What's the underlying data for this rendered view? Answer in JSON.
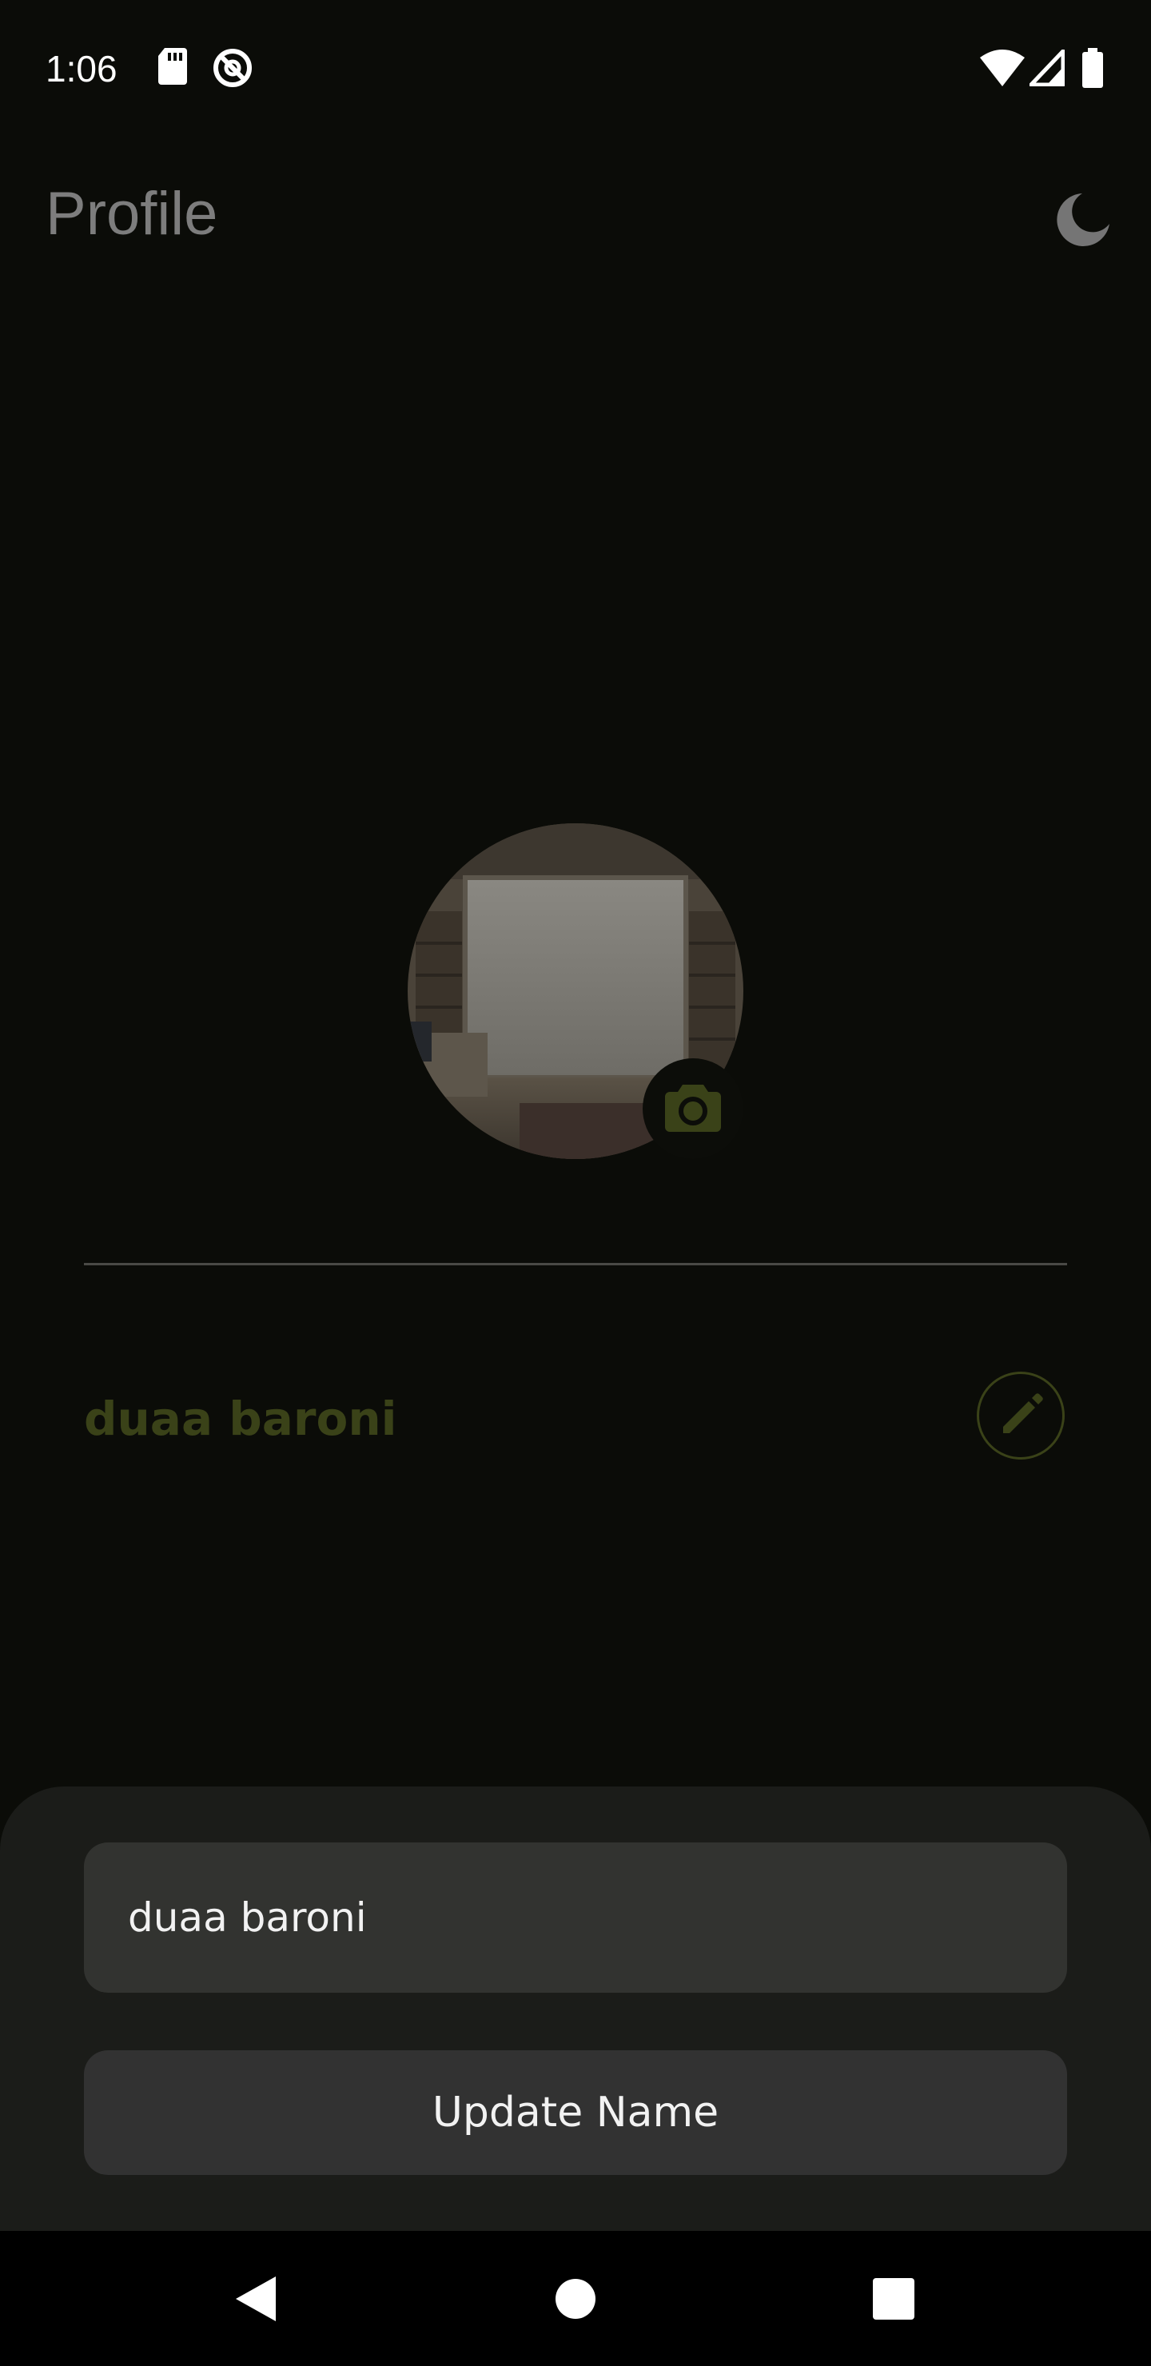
{
  "status_bar": {
    "time": "1:06",
    "icons": [
      "sd-card-icon",
      "do-not-disturb-icon",
      "wifi-icon",
      "cellular-signal-icon",
      "battery-icon"
    ]
  },
  "app_bar": {
    "title": "Profile",
    "theme_icon": "moon-icon"
  },
  "profile": {
    "avatar_description": "avatar",
    "camera_icon": "camera-icon",
    "name": "duaa baroni",
    "edit_icon": "pencil-icon"
  },
  "bottom_sheet": {
    "name_input_value": "duaa baroni",
    "update_button_label": "Update Name"
  },
  "nav_bar": {
    "buttons": [
      "back-icon",
      "home-icon",
      "recents-icon"
    ]
  },
  "colors": {
    "background": "#0b0c08",
    "accent": "#3a4218",
    "sheet": "#1b1c19",
    "field": "#323330"
  }
}
